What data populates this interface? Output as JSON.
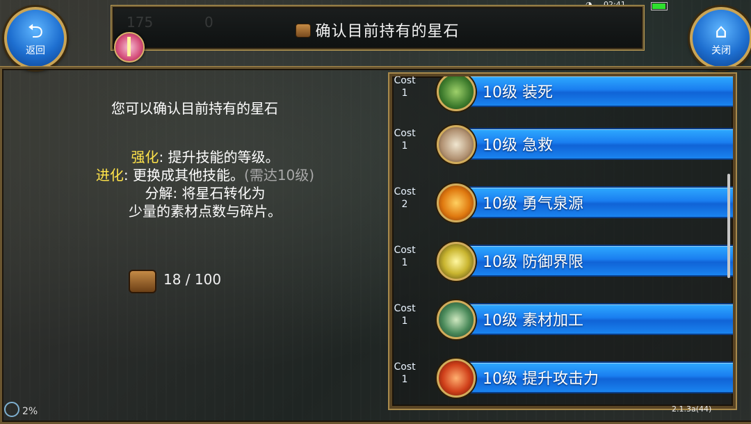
{
  "status": {
    "time": "02:41",
    "battery_level": 0.85
  },
  "nav": {
    "back_label": "返回",
    "close_label": "关闭"
  },
  "header": {
    "title": "确认目前持有的星石",
    "ghost_values": [
      "175",
      "0"
    ]
  },
  "info": {
    "intro": "您可以确认目前持有的星石",
    "line1_key": "强化",
    "line1_text": ": 提升技能的等级。",
    "line2_key": "进化",
    "line2_text": ": 更换成其他技能。",
    "line2_note": "(需达10级)",
    "line3": "分解: 将星石转化为",
    "line4": "少量的素材点数与碎片。",
    "held": "18 / 100"
  },
  "skills": {
    "cost_label": "Cost",
    "items": [
      {
        "name": "10级  装死",
        "cost": "1",
        "icon": "skull-icon",
        "color": "#3c7a2c"
      },
      {
        "name": "10级  急救",
        "cost": "1",
        "icon": "first-aid-icon",
        "color": "#b09070"
      },
      {
        "name": "10级  勇气泉源",
        "cost": "2",
        "icon": "flame-icon",
        "color": "#e07a10"
      },
      {
        "name": "10级  防御界限",
        "cost": "1",
        "icon": "shield-ring-icon",
        "color": "#c9b530"
      },
      {
        "name": "10级  素材加工",
        "cost": "1",
        "icon": "crafting-icon",
        "color": "#4a8a5a"
      },
      {
        "name": "10级  提升攻击力",
        "cost": "1",
        "icon": "sword-up-icon",
        "color": "#d0401a"
      }
    ]
  },
  "footer": {
    "progress": "2%",
    "version": "2.1.3a(44)"
  }
}
